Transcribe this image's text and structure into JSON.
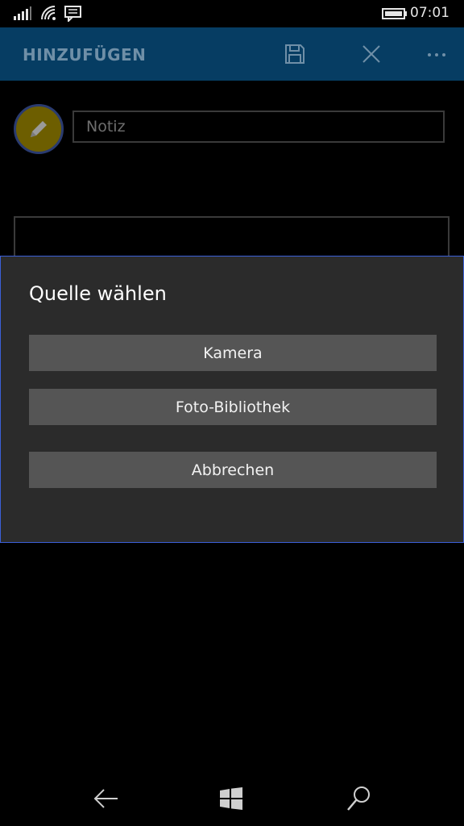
{
  "status_bar": {
    "time": "07:01",
    "icons": [
      "signal-icon",
      "wifi-icon",
      "message-icon",
      "battery-icon"
    ]
  },
  "app_bar": {
    "title": "HINZUFÜGEN",
    "actions": [
      "save-icon",
      "close-icon",
      "more-icon"
    ]
  },
  "form": {
    "avatar_icon": "pencil-icon",
    "note_placeholder": "Notiz"
  },
  "dialog": {
    "title": "Quelle wählen",
    "buttons": {
      "camera": "Kamera",
      "library": "Foto-Bibliothek",
      "cancel": "Abbrechen"
    }
  },
  "nav_bar": {
    "icons": [
      "back-arrow-icon",
      "windows-start-icon",
      "search-icon"
    ]
  },
  "colors": {
    "app_bar": "#063d63",
    "dialog_bg": "#2b2b2b",
    "dialog_border": "#3b5fd8",
    "button_bg": "#555555",
    "avatar_bg": "#6d5e00"
  }
}
